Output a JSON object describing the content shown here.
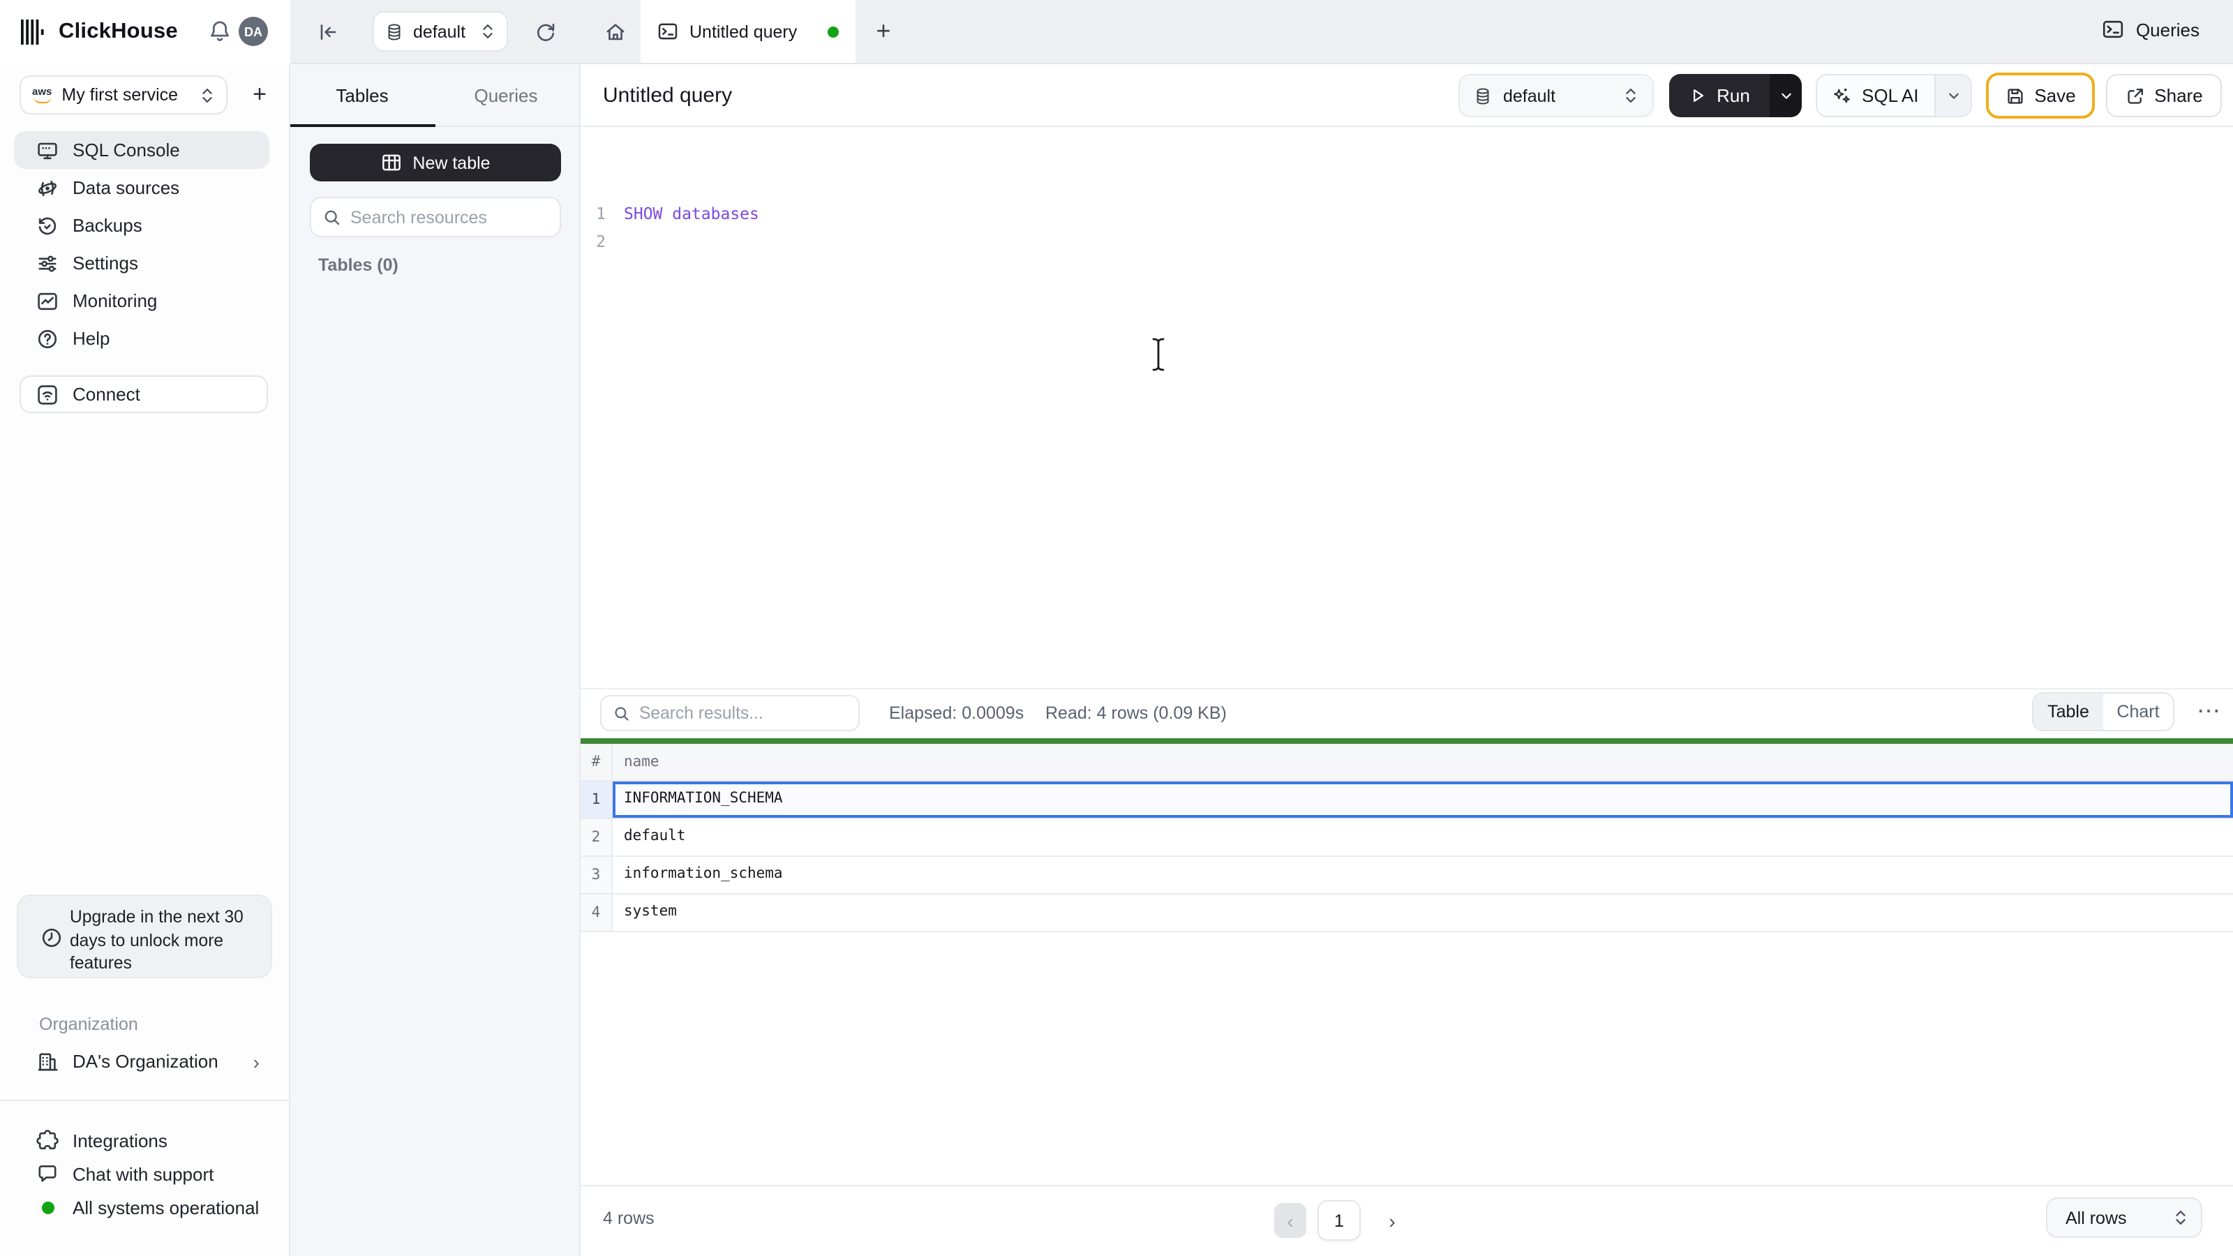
{
  "topbar": {
    "brand": "ClickHouse",
    "avatar_initials": "DA",
    "database_selector_value": "default",
    "tab_title": "Untitled query",
    "queries_label": "Queries"
  },
  "sidebar": {
    "service_selector": {
      "provider": "aws",
      "label": "My first service"
    },
    "nav_items": [
      {
        "label": "SQL Console",
        "icon": "sql-console-icon",
        "active": true
      },
      {
        "label": "Data sources",
        "icon": "data-sources-icon",
        "active": false
      },
      {
        "label": "Backups",
        "icon": "backups-icon",
        "active": false
      },
      {
        "label": "Settings",
        "icon": "settings-icon",
        "active": false
      },
      {
        "label": "Monitoring",
        "icon": "monitoring-icon",
        "active": false
      },
      {
        "label": "Help",
        "icon": "help-icon",
        "active": false
      }
    ],
    "connect_label": "Connect",
    "upgrade_notice_lines": [
      "Upgrade in the next 30",
      "days to unlock more",
      "features"
    ],
    "organization_section_label": "Organization",
    "organization_name": "DA's Organization",
    "integrations_label": "Integrations",
    "chat_label": "Chat with support",
    "status_label": "All systems operational",
    "status_color": "#12a312"
  },
  "explorer": {
    "tabs": [
      {
        "label": "Tables",
        "active": true
      },
      {
        "label": "Queries",
        "active": false
      }
    ],
    "new_table_label": "New table",
    "search_placeholder": "Search resources",
    "tables_count_label": "Tables (0)"
  },
  "query": {
    "title": "Untitled query",
    "database_selector_value": "default",
    "run_label": "Run",
    "sql_ai_label": "SQL AI",
    "save_label": "Save",
    "share_label": "Share",
    "editor_lines": [
      {
        "number": "1",
        "code": "SHOW databases"
      },
      {
        "number": "2",
        "code": ""
      }
    ]
  },
  "results": {
    "search_placeholder": "Search results...",
    "elapsed_label": "Elapsed: 0.0009s",
    "read_label": "Read: 4 rows (0.09 KB)",
    "view_toggle": [
      {
        "label": "Table",
        "active": true
      },
      {
        "label": "Chart",
        "active": false
      }
    ],
    "table": {
      "columns": [
        {
          "label": "#"
        },
        {
          "label": "name"
        }
      ],
      "rows": [
        {
          "num": "1",
          "name": "INFORMATION_SCHEMA",
          "selected": true
        },
        {
          "num": "2",
          "name": "default",
          "selected": false
        },
        {
          "num": "3",
          "name": "information_schema",
          "selected": false
        },
        {
          "num": "4",
          "name": "system",
          "selected": false
        }
      ]
    },
    "footer": {
      "rows_count_label": "4 rows",
      "current_page": "1",
      "page_size_label": "All rows"
    }
  },
  "colors": {
    "accent_green": "#12a312",
    "result_bar_green": "#3e8738",
    "selected_row_border": "#3c77e6",
    "sql_text_purple": "#7b4ae2",
    "save_border_orange": "#f0ad1d",
    "dark_button": "#26262c",
    "topbar_gray": "#edeff3",
    "panel_gray": "#f5f6f9"
  },
  "glyphs": {
    "plus": "+",
    "ellipsis": "⋯",
    "chevron_left": "‹",
    "chevron_right": "›"
  }
}
